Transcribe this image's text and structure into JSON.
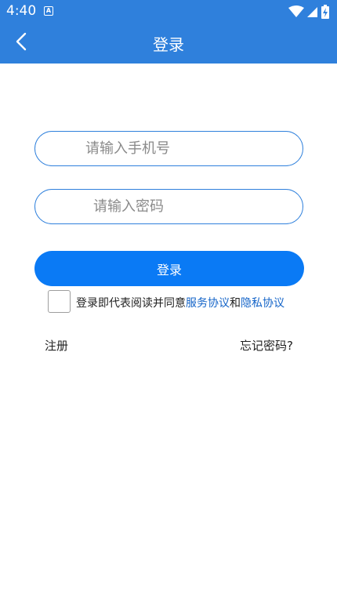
{
  "status_bar": {
    "time": "4:40",
    "notification_icon": "A"
  },
  "header": {
    "title": "登录",
    "back_icon": "chevron-left-icon"
  },
  "form": {
    "phone_placeholder": "请输入手机号",
    "phone_value": "",
    "password_placeholder": "请输入密码",
    "password_value": "",
    "login_label": "登录"
  },
  "agreement": {
    "checked": false,
    "prefix": "登录即代表阅读并同意",
    "service_link": "服务协议",
    "conjunction": "和",
    "privacy_link": "隐私协议"
  },
  "footer_links": {
    "register": "注册",
    "forgot": "忘记密码?"
  },
  "colors": {
    "header_bg": "#2f80dc",
    "button_bg": "#0a7af5",
    "link": "#1464c8"
  }
}
